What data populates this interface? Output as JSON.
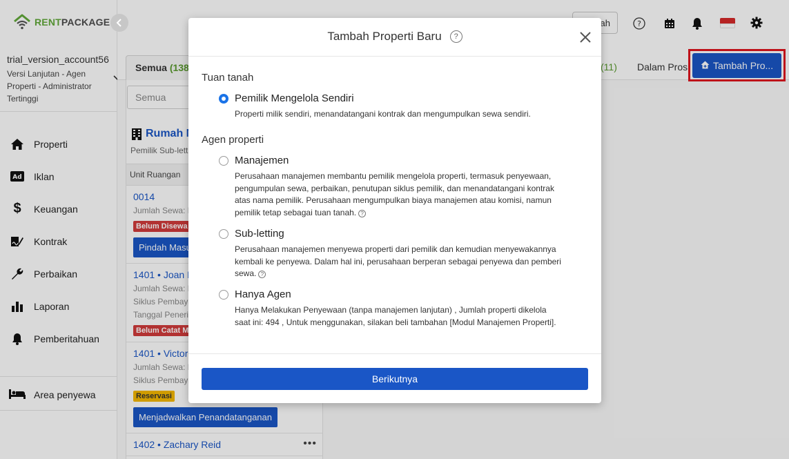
{
  "brand": {
    "name_part1": "RENT",
    "name_part2": "PACKAGE"
  },
  "account": {
    "name": "trial_version_account56",
    "role": "Versi Lanjutan - Agen Properti - Administrator Tertinggi"
  },
  "sidebar": {
    "items": [
      {
        "label": "Properti",
        "icon": "home-icon"
      },
      {
        "label": "Iklan",
        "icon": "ad-icon"
      },
      {
        "label": "Keuangan",
        "icon": "dollar-icon"
      },
      {
        "label": "Kontrak",
        "icon": "contract-icon"
      },
      {
        "label": "Perbaikan",
        "icon": "wrench-icon"
      },
      {
        "label": "Laporan",
        "icon": "chart-icon"
      },
      {
        "label": "Pemberitahuan",
        "icon": "bell-icon"
      }
    ],
    "tenant_area": "Area penyewa"
  },
  "topbar": {
    "button_label": "ah"
  },
  "tabs": {
    "all_label": "Semua",
    "all_count": "(138)",
    "count_11": "(11)",
    "in_process": "Dalam Pros"
  },
  "add_button": "Tambah Pro...",
  "list": {
    "search_placeholder": "Semua",
    "property_name": "Rumah N",
    "property_sub": "Pemilik Sub-lett",
    "column_header": "Unit Ruangan",
    "units": [
      {
        "title": "0014",
        "lines": [
          "Jumlah Sewa: R"
        ],
        "badge": "Belum Disewa",
        "badge_color": "red",
        "button": "Pindah Masuk"
      },
      {
        "title": "1401 • Joan R",
        "lines": [
          "Jumlah Sewa: R",
          "Siklus Pembaya",
          "Tanggal Peneri"
        ],
        "badge": "Belum Catat Me",
        "badge_color": "red",
        "button": ""
      },
      {
        "title": "1401 • Victor",
        "lines": [
          "Jumlah Sewa: R",
          "Siklus Pembaya"
        ],
        "badge": "Reservasi",
        "badge_color": "yellow",
        "button": "Menjadwalkan Penandatanganan"
      },
      {
        "title": "1402 • Zachary Reid",
        "lines": [],
        "badge": "",
        "badge_color": "",
        "button": ""
      }
    ]
  },
  "modal": {
    "title": "Tambah Properti Baru",
    "section_landlord": "Tuan tanah",
    "section_agent": "Agen properti",
    "options": [
      {
        "label": "Pemilik Mengelola Sendiri",
        "selected": true,
        "desc": "Properti milik sendiri, menandatangani kontrak dan mengumpulkan sewa sendiri."
      },
      {
        "label": "Manajemen",
        "selected": false,
        "desc": "Perusahaan manajemen membantu pemilik mengelola properti, termasuk penyewaan, pengumpulan sewa, perbaikan, penutupan siklus pemilik, dan menandatangani kontrak atas nama pemilik. Perusahaan mengumpulkan biaya manajemen atau komisi, namun pemilik tetap sebagai tuan tanah."
      },
      {
        "label": "Sub-letting",
        "selected": false,
        "desc": "Perusahaan manajemen menyewa properti dari pemilik dan kemudian menyewakannya kembali ke penyewa. Dalam hal ini, perusahaan berperan sebagai penyewa dan pemberi sewa."
      },
      {
        "label": "Hanya Agen",
        "selected": false,
        "desc": "Hanya Melakukan Penyewaan (tanpa manajemen lanjutan) , Jumlah properti dikelola saat ini: 494 , Untuk menggunakan, silakan beli tambahan [Modul Manajemen Properti]."
      }
    ],
    "next_button": "Berikutnya"
  },
  "colors": {
    "primary": "#1a56c6",
    "brand_green": "#62aa3a",
    "highlight": "#e0141e",
    "badge_red": "#d23b3b",
    "badge_yellow": "#f5b800",
    "radio_selected": "#1a73e8"
  }
}
